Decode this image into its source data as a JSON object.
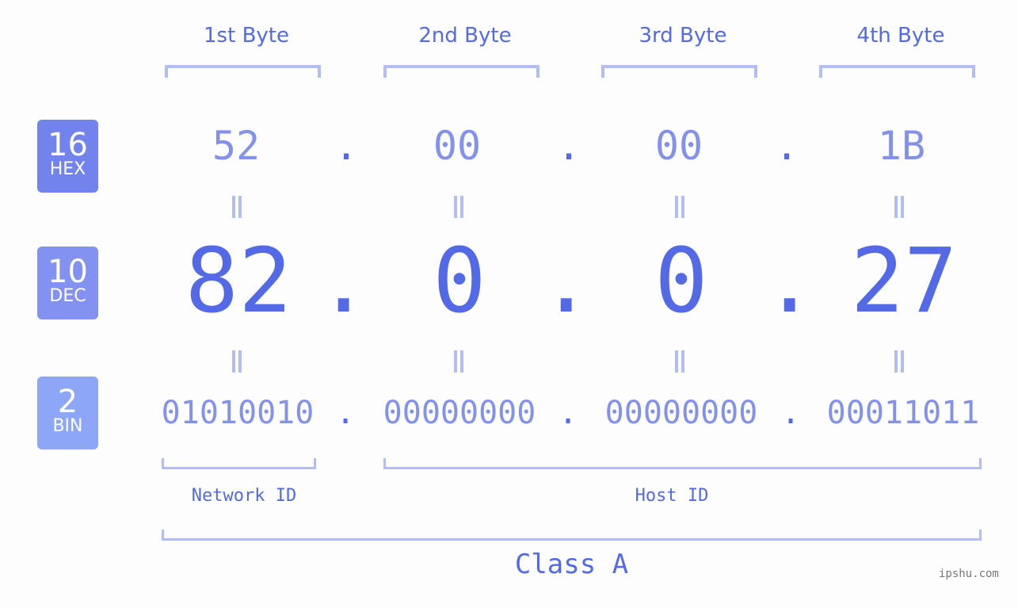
{
  "byte_headers": [
    "1st Byte",
    "2nd Byte",
    "3rd Byte",
    "4th Byte"
  ],
  "badges": {
    "hex": {
      "base": "16",
      "label": "HEX",
      "color": "#7383ed"
    },
    "dec": {
      "base": "10",
      "label": "DEC",
      "color": "#8392f0"
    },
    "bin": {
      "base": "2",
      "label": "BIN",
      "color": "#8ea6f8"
    }
  },
  "hex": [
    "52",
    "00",
    "00",
    "1B"
  ],
  "dec": [
    "82",
    "0",
    "0",
    "27"
  ],
  "bin": [
    "01010010",
    "00000000",
    "00000000",
    "00011011"
  ],
  "separator": ".",
  "network_id_label": "Network ID",
  "host_id_label": "Host ID",
  "class_label": "Class A",
  "watermark": "ipshu.com"
}
